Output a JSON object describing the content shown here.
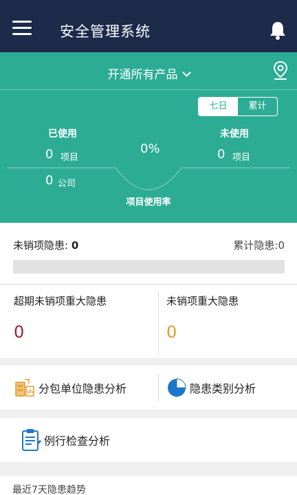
{
  "header": {
    "title": "安全管理系统"
  },
  "hero": {
    "product_select": "开通所有产品",
    "range_tabs": [
      "七日",
      "累计"
    ],
    "active_tab": "七日",
    "used_label": "已使用",
    "used_projects": "0",
    "used_companies": "0",
    "unused_label": "未使用",
    "unused_projects": "0",
    "unit_project": "项目",
    "unit_company": "公司",
    "usage_rate": "0%",
    "usage_rate_label": "项目使用率"
  },
  "hazards": {
    "unresolved_label": "未销项隐患: ",
    "unresolved_value": "0",
    "cumulative_text": "累计隐患:0",
    "progress_fraction": 0
  },
  "major": {
    "overdue_title": "超期未销项重大隐患",
    "overdue_value": "0",
    "unresolved_title": "未销项重大隐患",
    "unresolved_value": "0"
  },
  "analysis": {
    "subcontractor": "分包单位隐患分析",
    "category": "隐患类别分析",
    "routine": "例行检查分析"
  },
  "trend": {
    "title": "最近7天隐患趋势"
  },
  "colors": {
    "header_bg": "#1d2a4a",
    "accent": "#2cac94",
    "overdue_red": "#a0222a",
    "orange": "#e59a2e",
    "pie_blue": "#1e76c9"
  }
}
